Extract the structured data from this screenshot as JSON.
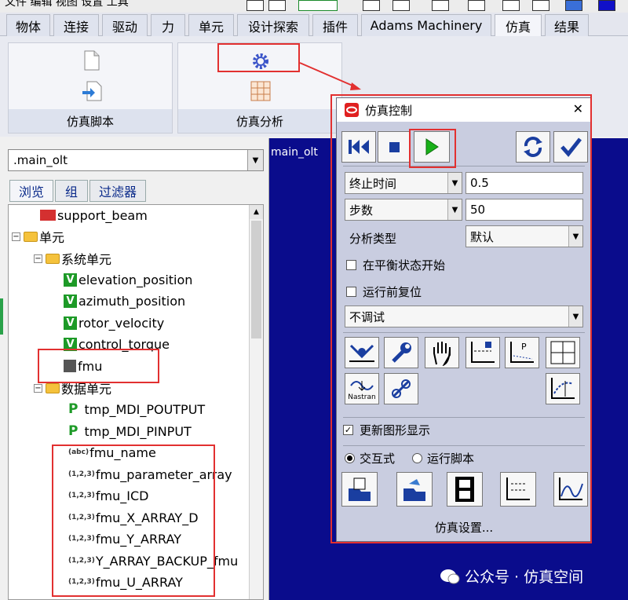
{
  "top_menu": "文件 编辑 视图 设置 工具",
  "ribbon_tabs": [
    "物体",
    "连接",
    "驱动",
    "力",
    "单元",
    "设计探索",
    "插件",
    "Adams Machinery",
    "仿真",
    "结果"
  ],
  "ribbon_groups": [
    {
      "label": "仿真脚本"
    },
    {
      "label": "仿真分析"
    }
  ],
  "model_combo": ".main_olt",
  "side_tabs": [
    "浏览",
    "组",
    "过滤器"
  ],
  "tree": [
    {
      "label": "support_beam",
      "icon": "beam-icon"
    },
    {
      "label": "单元",
      "icon": "folder-icon"
    },
    {
      "label": "系统单元",
      "icon": "folder-icon"
    },
    {
      "label": "elevation_position",
      "icon": "v-icon"
    },
    {
      "label": "azimuth_position",
      "icon": "v-icon"
    },
    {
      "label": "rotor_velocity",
      "icon": "v-icon"
    },
    {
      "label": "control_torque",
      "icon": "v-icon"
    },
    {
      "label": "fmu",
      "icon": "fmu-icon"
    },
    {
      "label": "数据单元",
      "icon": "folder-icon"
    },
    {
      "label": "tmp_MDI_POUTPUT",
      "icon": "p-out-icon"
    },
    {
      "label": "tmp_MDI_PINPUT",
      "icon": "p-in-icon"
    },
    {
      "label": "fmu_name",
      "icon": "abc-icon"
    },
    {
      "label": "fmu_parameter_array",
      "icon": "num-icon"
    },
    {
      "label": "fmu_ICD",
      "icon": "num-icon"
    },
    {
      "label": "fmu_X_ARRAY_D",
      "icon": "num-icon"
    },
    {
      "label": "fmu_Y_ARRAY",
      "icon": "num-icon"
    },
    {
      "label": "Y_ARRAY_BACKUP_fmu",
      "icon": "num-icon"
    },
    {
      "label": "fmu_U_ARRAY",
      "icon": "num-icon"
    }
  ],
  "icon_text": {
    "abc": "(abc)",
    "num": "(1,2,3)",
    "p": "P",
    "v": "V"
  },
  "viewport_title": "main_olt",
  "dialog": {
    "title": "仿真控制",
    "close_glyph": "✕",
    "end_mode": "终止时间",
    "end_value": "0.5",
    "step_mode": "步数",
    "step_value": "50",
    "analysis_label": "分析类型",
    "analysis_value": "默认",
    "start_equilibrium": "在平衡状态开始",
    "reset_before_run": "运行前复位",
    "debug_value": "不调试",
    "nastran_label": "Nastran",
    "update_graphics": "更新图形显示",
    "interactive": "交互式",
    "run_script": "运行脚本",
    "sim_settings": "仿真设置..."
  },
  "watermark": "公众号 · 仿真空间",
  "colors": {
    "viewport": "#0a0c8c",
    "highlight": "#e23030",
    "dialog_bg": "#c9cde0"
  }
}
